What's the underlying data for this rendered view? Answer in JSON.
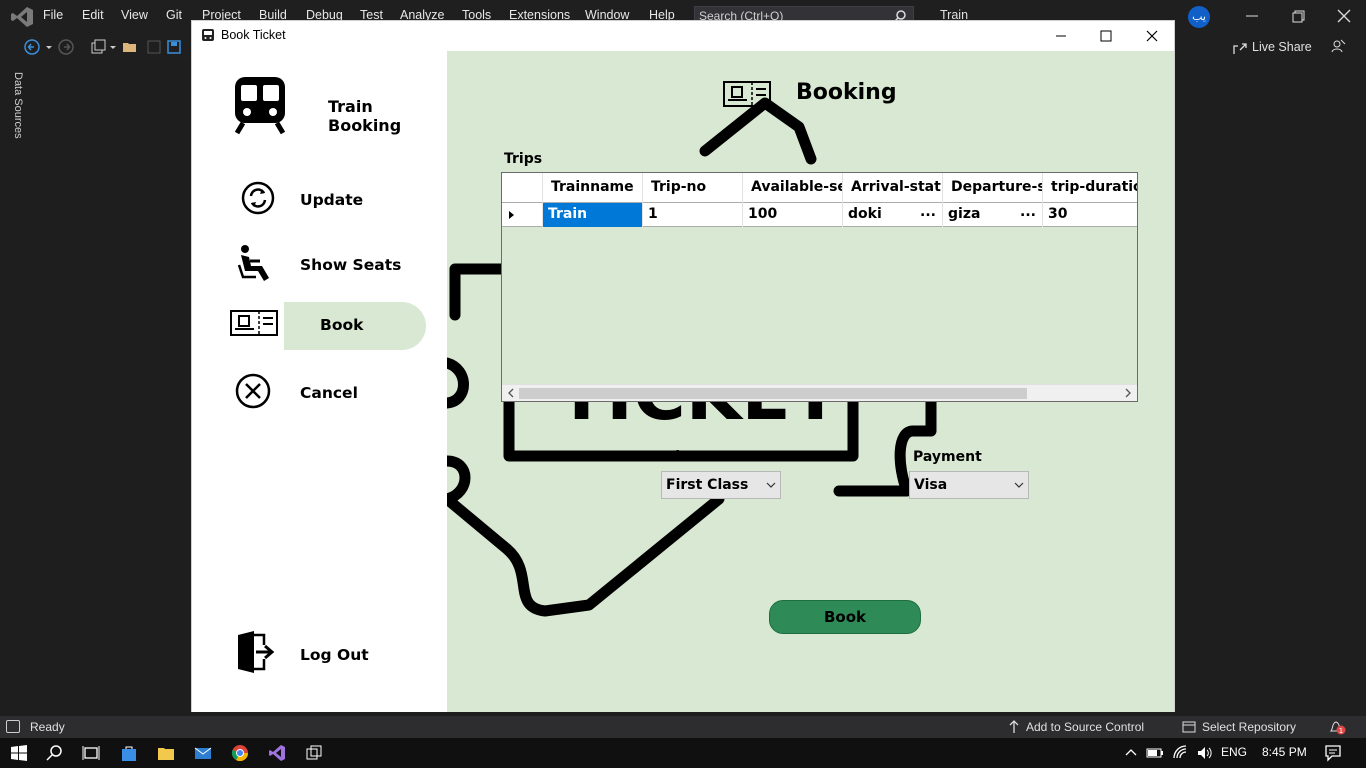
{
  "ide": {
    "menu": [
      "File",
      "Edit",
      "View",
      "Git",
      "Project",
      "Build",
      "Debug",
      "Test",
      "Analyze",
      "Tools",
      "Extensions",
      "Window",
      "Help"
    ],
    "search_placeholder": "Search (Ctrl+Q)",
    "solution_title": "Train",
    "avatar_text": "یب",
    "live_share": "Live Share",
    "data_sources": "Data Sources",
    "status": {
      "ready": "Ready",
      "add_source_control": "Add to Source Control",
      "select_repository": "Select Repository",
      "notification_count": "1"
    }
  },
  "taskbar": {
    "language": "ENG",
    "time": "8:45 PM"
  },
  "window": {
    "title": "Book Ticket"
  },
  "sidebar": {
    "brand": "Train Booking",
    "items": [
      {
        "label": "Update",
        "icon": "refresh-icon"
      },
      {
        "label": "Show Seats",
        "icon": "seat-icon"
      },
      {
        "label": "Book",
        "icon": "ticket-icon",
        "active": true
      },
      {
        "label": "Cancel",
        "icon": "cancel-icon"
      },
      {
        "label": "Log Out",
        "icon": "logout-icon"
      }
    ]
  },
  "main": {
    "title": "Booking",
    "trips_label": "Trips",
    "grid": {
      "columns": [
        "Trainname",
        "Trip-no",
        "Available-se",
        "Arrival-stat",
        "Departure-s",
        "trip-duratio"
      ],
      "rows": [
        {
          "trainname": "Train",
          "trip_no": "1",
          "available": "100",
          "arrival": "doki",
          "departure": "giza",
          "duration": "30"
        }
      ],
      "ellipsis": "..."
    },
    "class_label": "Class",
    "class_value": "First Class",
    "payment_label": "Payment",
    "payment_value": "Visa",
    "book_button": "Book"
  },
  "colors": {
    "content_bg": "#d8e8d2",
    "book_button": "#2e8b57",
    "selection": "#0078d7"
  }
}
